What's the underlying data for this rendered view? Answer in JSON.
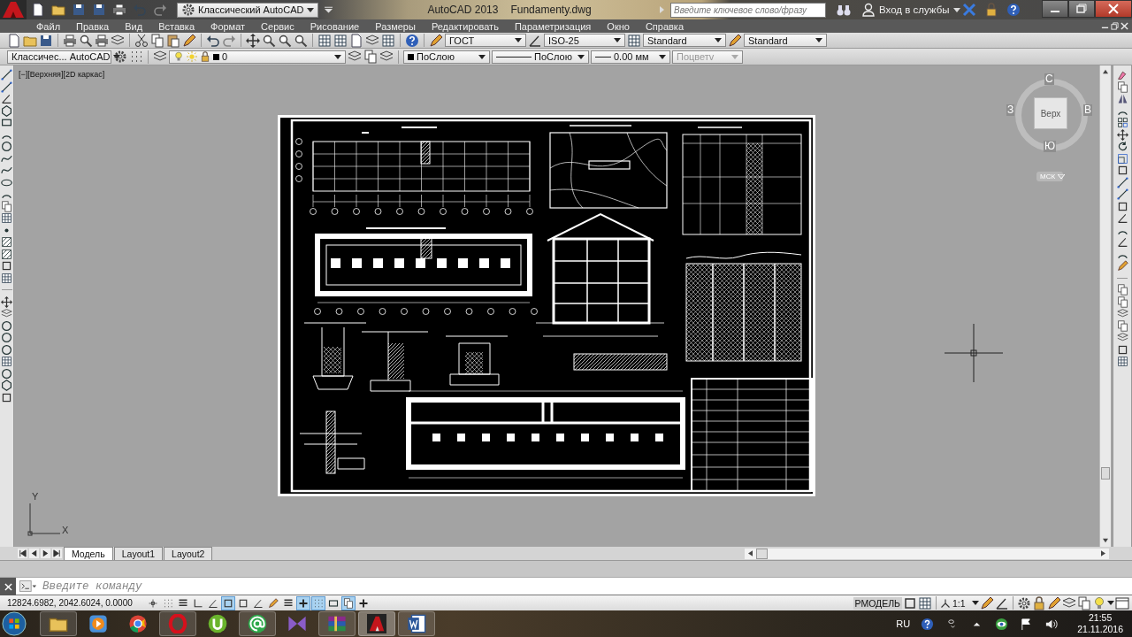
{
  "title_bar": {
    "workspace": "Классический AutoCAD",
    "app_name": "AutoCAD 2013",
    "file_name": "Fundamenty.dwg",
    "search": {
      "placeholder": "Введите ключевое слово/фразу"
    },
    "sign_in": "Вход в службы"
  },
  "menu": [
    "Файл",
    "Правка",
    "Вид",
    "Вставка",
    "Формат",
    "Сервис",
    "Рисование",
    "Размеры",
    "Редактировать",
    "Параметризация",
    "Окно",
    "Справка"
  ],
  "styles_toolbar": {
    "text_style": "ГОСТ",
    "dim_style": "ISO-25",
    "table_style": "Standard",
    "multileader_style": "Standard"
  },
  "properties_toolbar": {
    "workspace": "Классичес... AutoCAD",
    "layer": "0",
    "object_color": "ПоСлою",
    "linetype": "ПоСлою",
    "lineweight": "0.00 мм",
    "plot_style": {
      "value": "Поцветv",
      "disabled": true
    }
  },
  "viewport": {
    "label": "[−][Верхняя][2D каркас]",
    "viewcube": {
      "face": "Верх",
      "north": "С",
      "east": "В",
      "south": "Ю",
      "west": "З",
      "ucs": "МСК"
    },
    "ucs_axes": {
      "x": "X",
      "y": "Y"
    }
  },
  "layout_tabs": [
    {
      "label": "Модель",
      "selected": true
    },
    {
      "label": "Layout1",
      "selected": false
    },
    {
      "label": "Layout2",
      "selected": false
    }
  ],
  "command_line": {
    "placeholder": "Введите команду"
  },
  "status_bar": {
    "coordinates": "12824.6982, 2042.6024, 0.0000",
    "toggles": [
      {
        "on": false
      },
      {
        "on": false
      },
      {
        "on": false
      },
      {
        "on": false
      },
      {
        "on": false
      },
      {
        "on": true
      },
      {
        "on": false
      },
      {
        "on": false
      },
      {
        "on": false
      },
      {
        "on": false
      },
      {
        "on": true
      },
      {
        "on": true
      },
      {
        "on": false
      },
      {
        "on": true
      },
      {
        "on": false
      }
    ],
    "space": "РМОДЕЛЬ",
    "annotation_scale": "1:1"
  },
  "taskbar": {
    "language": "RU",
    "time": "21:55",
    "date": "21.11.2016"
  }
}
